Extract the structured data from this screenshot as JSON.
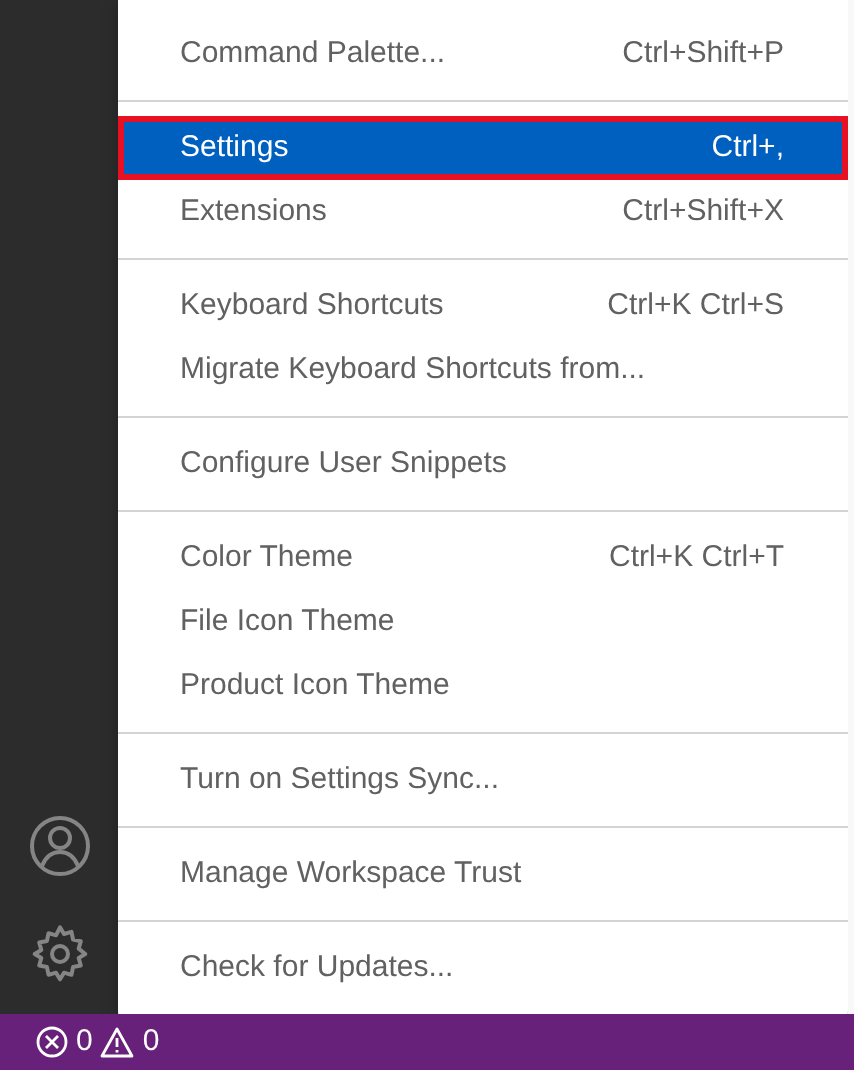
{
  "menu": {
    "groups": [
      [
        {
          "label": "Command Palette...",
          "shortcut": "Ctrl+Shift+P",
          "selected": false
        }
      ],
      [
        {
          "label": "Settings",
          "shortcut": "Ctrl+,",
          "selected": true
        },
        {
          "label": "Extensions",
          "shortcut": "Ctrl+Shift+X",
          "selected": false
        }
      ],
      [
        {
          "label": "Keyboard Shortcuts",
          "shortcut": "Ctrl+K Ctrl+S",
          "selected": false
        },
        {
          "label": "Migrate Keyboard Shortcuts from...",
          "selected": false
        }
      ],
      [
        {
          "label": "Configure User Snippets",
          "selected": false
        }
      ],
      [
        {
          "label": "Color Theme",
          "shortcut": "Ctrl+K Ctrl+T",
          "selected": false
        },
        {
          "label": "File Icon Theme",
          "selected": false
        },
        {
          "label": "Product Icon Theme",
          "selected": false
        }
      ],
      [
        {
          "label": "Turn on Settings Sync...",
          "selected": false
        }
      ],
      [
        {
          "label": "Manage Workspace Trust",
          "selected": false
        }
      ],
      [
        {
          "label": "Check for Updates...",
          "selected": false
        }
      ]
    ]
  },
  "status_bar": {
    "errors": "0",
    "warnings": "0"
  }
}
